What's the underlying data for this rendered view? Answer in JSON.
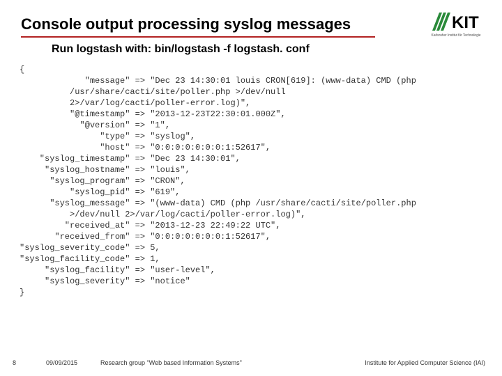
{
  "header": {
    "title": "Console output processing syslog messages",
    "subtitle": "Run logstash with: bin/logstash -f logstash. conf"
  },
  "logo": {
    "label": "KIT",
    "tagline": "Karlsruher Institut für Technologie"
  },
  "console": {
    "open": "{",
    "close": "}",
    "entries": [
      {
        "key": "\"message\"",
        "value": "\"Dec 23 14:30:01 louis CRON[619]: (www-data) CMD (php",
        "cont": [
          "/usr/share/cacti/site/poller.php >/dev/null",
          "2>/var/log/cacti/poller-error.log)\","
        ]
      },
      {
        "key": "\"@timestamp\"",
        "value": "\"2013-12-23T22:30:01.000Z\","
      },
      {
        "key": "\"@version\"",
        "value": "\"1\","
      },
      {
        "key": "\"type\"",
        "value": "\"syslog\","
      },
      {
        "key": "\"host\"",
        "value": "\"0:0:0:0:0:0:0:1:52617\","
      },
      {
        "key": "\"syslog_timestamp\"",
        "value": "\"Dec 23 14:30:01\","
      },
      {
        "key": "\"syslog_hostname\"",
        "value": "\"louis\","
      },
      {
        "key": "\"syslog_program\"",
        "value": "\"CRON\","
      },
      {
        "key": "\"syslog_pid\"",
        "value": "\"619\","
      },
      {
        "key": "\"syslog_message\"",
        "value": "\"(www-data) CMD (php /usr/share/cacti/site/poller.php",
        "cont": [
          ">/dev/null 2>/var/log/cacti/poller-error.log)\","
        ]
      },
      {
        "key": "\"received_at\"",
        "value": "\"2013-12-23 22:49:22 UTC\","
      },
      {
        "key": "\"received_from\"",
        "value": "\"0:0:0:0:0:0:0:1:52617\","
      },
      {
        "key": "\"syslog_severity_code\"",
        "value": "5,"
      },
      {
        "key": "\"syslog_facility_code\"",
        "value": "1,"
      },
      {
        "key": "\"syslog_facility\"",
        "value": "\"user-level\","
      },
      {
        "key": "\"syslog_severity\"",
        "value": "\"notice\""
      }
    ]
  },
  "footer": {
    "page": "8",
    "date": "09/09/2015",
    "group": "Research group \"Web based Information Systems\"",
    "institute": "Institute for Applied Computer Science (IAI)"
  }
}
